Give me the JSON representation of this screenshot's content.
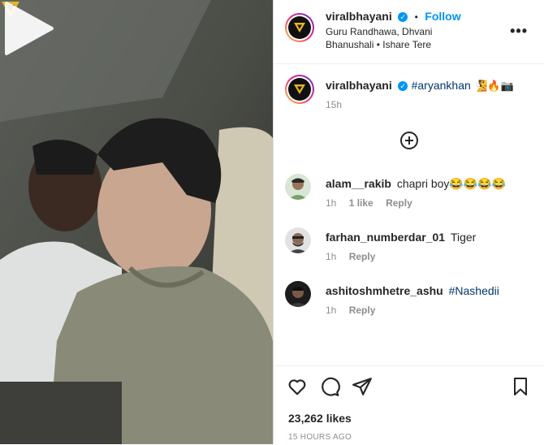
{
  "post": {
    "author": "viralbhayani",
    "follow_label": "Follow",
    "bullet": "•",
    "location": "Guru Randhawa, Dhvani Bhanushali • Ishare Tere",
    "more": "•••"
  },
  "caption": {
    "author": "viralbhayani",
    "hashtag": "#aryankhan",
    "emojis": "🧏🔥📷",
    "time": "15h"
  },
  "comments": [
    {
      "user": "alam__rakib",
      "text": "chapri boy😂😂😂😂",
      "time": "1h",
      "likes": "1 like",
      "reply": "Reply"
    },
    {
      "user": "farhan_numberdar_01",
      "text": "Tiger",
      "time": "1h",
      "likes": "",
      "reply": "Reply"
    },
    {
      "user": "ashitoshmhetre_ashu",
      "text": "#Nashedii",
      "time": "1h",
      "likes": "",
      "reply": "Reply"
    }
  ],
  "footer": {
    "likes": "23,262 likes",
    "posted": "15 HOURS AGO"
  },
  "icons": [
    "verified-badge-icon",
    "more-options-icon",
    "load-more-plus-icon",
    "heart-icon",
    "comment-icon",
    "share-icon",
    "save-icon",
    "play-icon"
  ],
  "colors": {
    "accent": "#0095f6",
    "hashtag": "#00376b",
    "muted": "#8e8e8e"
  }
}
